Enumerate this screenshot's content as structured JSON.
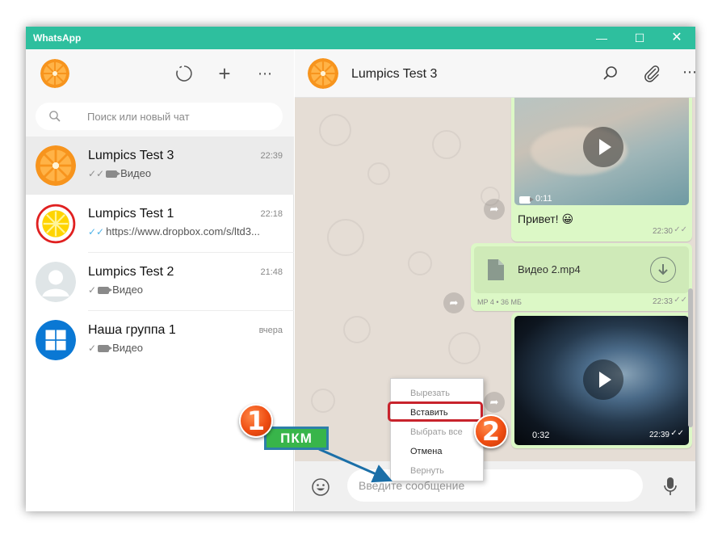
{
  "window": {
    "title": "WhatsApp"
  },
  "titlebar": {
    "minimize": "—",
    "maximize": "☐",
    "close": "✕"
  },
  "left_header": {
    "menu_glyph": "⋯",
    "new_chat_glyph": "+"
  },
  "search": {
    "placeholder": "Поиск или новый чат"
  },
  "chats": [
    {
      "name": "Lumpics Test 3",
      "time": "22:39",
      "ticks": "✓✓",
      "ticks_read": false,
      "preview": "Видео",
      "has_video_icon": true,
      "avatar": "orange"
    },
    {
      "name": "Lumpics Test 1",
      "time": "22:18",
      "ticks": "✓✓",
      "ticks_read": true,
      "preview": "https://www.dropbox.com/s/ltd3...",
      "has_video_icon": false,
      "avatar": "lemon"
    },
    {
      "name": "Lumpics Test 2",
      "time": "21:48",
      "ticks": "✓",
      "ticks_read": false,
      "preview": "Видео",
      "has_video_icon": true,
      "avatar": "default-person"
    },
    {
      "name": "Наша группа 1",
      "time": "вчера",
      "ticks": "✓",
      "ticks_read": false,
      "preview": "Видео",
      "has_video_icon": true,
      "avatar": "windows-logo"
    }
  ],
  "conversation": {
    "contact_name": "Lumpics Test 3",
    "messages": [
      {
        "type": "video",
        "duration": "0:11",
        "caption": "Привет! 😀",
        "time": "22:30",
        "ticks": "✓✓"
      },
      {
        "type": "file",
        "filename": "Видео 2.mp4",
        "meta": "MP 4 • 36 МБ",
        "time": "22:33",
        "ticks": "✓✓"
      },
      {
        "type": "video",
        "duration": "0:32",
        "time": "22:39",
        "ticks": "✓✓"
      }
    ],
    "input_placeholder": "Введите сообщение"
  },
  "context_menu": {
    "items": [
      {
        "label": "Вырезать",
        "enabled": false
      },
      {
        "label": "Вставить",
        "enabled": true,
        "highlighted": true
      },
      {
        "label": "Выбрать все",
        "enabled": false
      },
      {
        "label": "Отмена",
        "enabled": true
      },
      {
        "label": "Вернуть",
        "enabled": false
      }
    ]
  },
  "annotations": {
    "step1": "1",
    "step2": "2",
    "label": "ПКМ"
  },
  "colors": {
    "accent": "#2ebf9e",
    "bubble_out": "#dcf8c6",
    "chat_bg": "#e5ddd5",
    "highlight_border": "#c8232c",
    "badge": "#ef4d12",
    "pkm_fill": "#38b54a",
    "pkm_border": "#2d7fa9",
    "read_ticks": "#4fb3e8"
  }
}
